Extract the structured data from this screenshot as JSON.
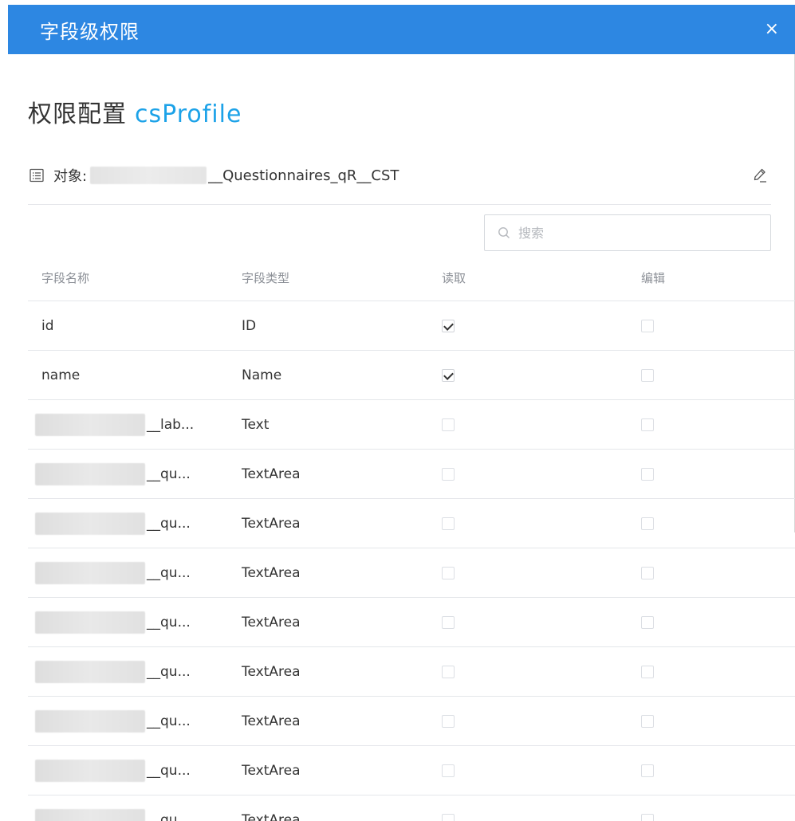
{
  "header": {
    "title": "字段级权限",
    "close": "×"
  },
  "page": {
    "title_prefix": "权限配置",
    "title_accent": "csProfile",
    "accent_color": "#1ca2e8",
    "header_color": "#2d87e2"
  },
  "object": {
    "label": "对象:",
    "suffix": "__Questionnaires_qR__CST"
  },
  "search": {
    "placeholder": "搜索"
  },
  "table": {
    "headers": [
      "字段名称",
      "字段类型",
      "读取",
      "编辑"
    ],
    "rows": [
      {
        "name": "id",
        "type": "ID",
        "read": true,
        "edit": false,
        "redacted": false
      },
      {
        "name": "name",
        "type": "Name",
        "read": true,
        "edit": false,
        "redacted": false
      },
      {
        "name": "__lab...",
        "type": "Text",
        "read": false,
        "edit": false,
        "redacted": true
      },
      {
        "name": "__qu...",
        "type": "TextArea",
        "read": false,
        "edit": false,
        "redacted": true
      },
      {
        "name": "__qu...",
        "type": "TextArea",
        "read": false,
        "edit": false,
        "redacted": true
      },
      {
        "name": "__qu...",
        "type": "TextArea",
        "read": false,
        "edit": false,
        "redacted": true
      },
      {
        "name": "__qu...",
        "type": "TextArea",
        "read": false,
        "edit": false,
        "redacted": true
      },
      {
        "name": "__qu...",
        "type": "TextArea",
        "read": false,
        "edit": false,
        "redacted": true
      },
      {
        "name": "__qu...",
        "type": "TextArea",
        "read": false,
        "edit": false,
        "redacted": true
      },
      {
        "name": "__qu...",
        "type": "TextArea",
        "read": false,
        "edit": false,
        "redacted": true
      },
      {
        "name": "__qu...",
        "type": "TextArea",
        "read": false,
        "edit": false,
        "redacted": true
      }
    ]
  },
  "icons": {
    "close": "close-icon",
    "object": "list-icon",
    "edit": "pencil-icon",
    "search": "search-icon"
  }
}
